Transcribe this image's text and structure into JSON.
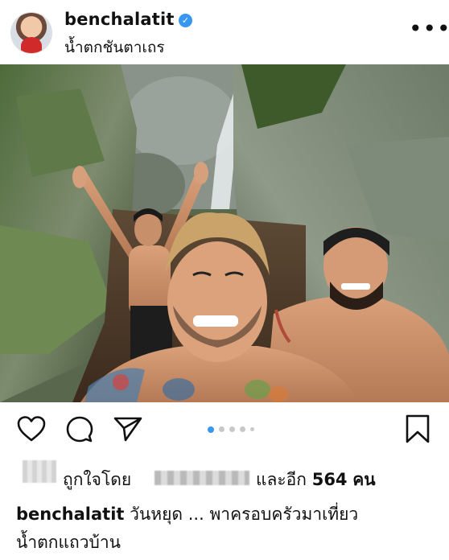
{
  "post": {
    "username": "benchalatit",
    "verified": true,
    "location": "น้ำตกชันตาเถร",
    "menu_icon": "more-horizontal-icon",
    "photo_description_icon": "waterfall-selfie-photo"
  },
  "actions": {
    "like_icon": "heart-icon",
    "comment_icon": "comment-icon",
    "share_icon": "send-icon",
    "save_icon": "bookmark-icon",
    "carousel_count": 5,
    "carousel_active_index": 0,
    "active_dot_color": "#3897f0"
  },
  "likes": {
    "prefix": "ถูกใจโดย",
    "suffix": "และอีก",
    "count": "564",
    "unit": "คน"
  },
  "caption": {
    "username": "benchalatit",
    "text_line1": "วันหยุด ... พาครอบครัวมาเที่ยว",
    "text_line2": "น้ำตกแถวบ้าน"
  }
}
